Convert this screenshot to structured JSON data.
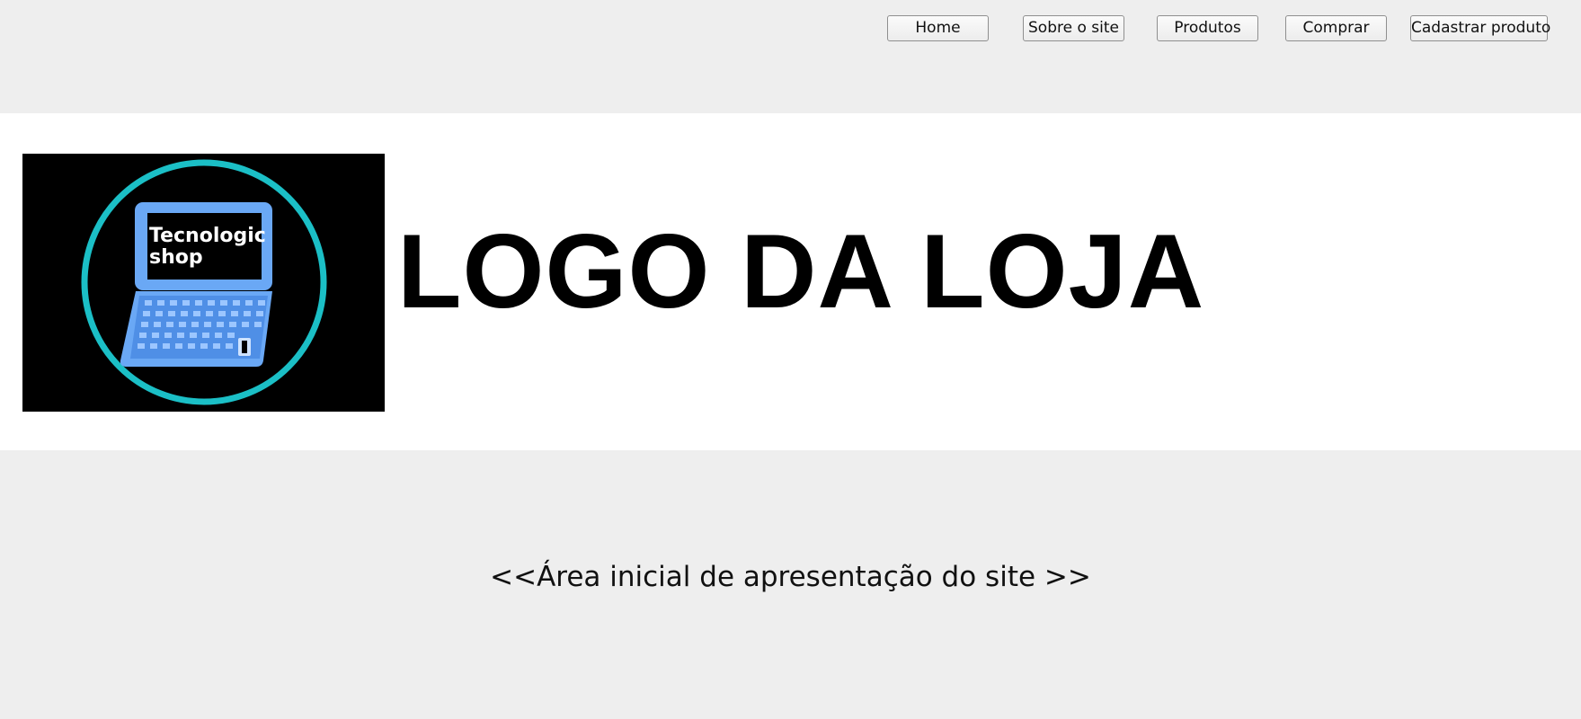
{
  "nav": {
    "items": [
      {
        "label": "Home"
      },
      {
        "label": "Sobre o site"
      },
      {
        "label": "Produtos"
      },
      {
        "label": "Comprar"
      },
      {
        "label": "Cadastrar produto"
      }
    ]
  },
  "logo": {
    "line1": "Tecnologic",
    "line2": "shop",
    "colors": {
      "background": "#000000",
      "ring": "#1bbfc6",
      "laptop": "#6aa8f5",
      "laptop_dark": "#4f8fe6"
    }
  },
  "banner": {
    "title": "LOGO DA LOJA"
  },
  "hero": {
    "text": "<<Área inicial de apresentação do site >>"
  }
}
